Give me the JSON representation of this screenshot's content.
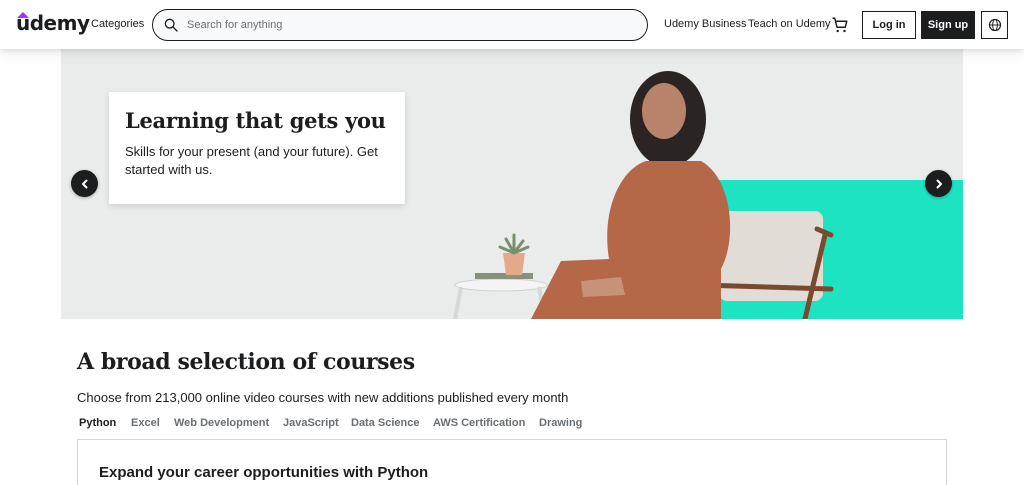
{
  "header": {
    "logo_text": "udemy",
    "categories": "Categories",
    "search_placeholder": "Search for anything",
    "business": "Udemy Business",
    "teach": "Teach on Udemy",
    "login": "Log in",
    "signup": "Sign up",
    "brand_color": "#a435f0"
  },
  "hero": {
    "title": "Learning that gets you",
    "subtitle": "Skills for your present (and your future). Get started with us.",
    "accent_color": "#1ee3c3"
  },
  "section": {
    "title": "A broad selection of courses",
    "subtitle": "Choose from 213,000 online video courses with new additions published every month",
    "tabs": [
      {
        "label": "Python",
        "active": true
      },
      {
        "label": "Excel",
        "active": false
      },
      {
        "label": "Web Development",
        "active": false
      },
      {
        "label": "JavaScript",
        "active": false
      },
      {
        "label": "Data Science",
        "active": false
      },
      {
        "label": "AWS Certification",
        "active": false
      },
      {
        "label": "Drawing",
        "active": false
      }
    ],
    "panel_title": "Expand your career opportunities with Python"
  }
}
